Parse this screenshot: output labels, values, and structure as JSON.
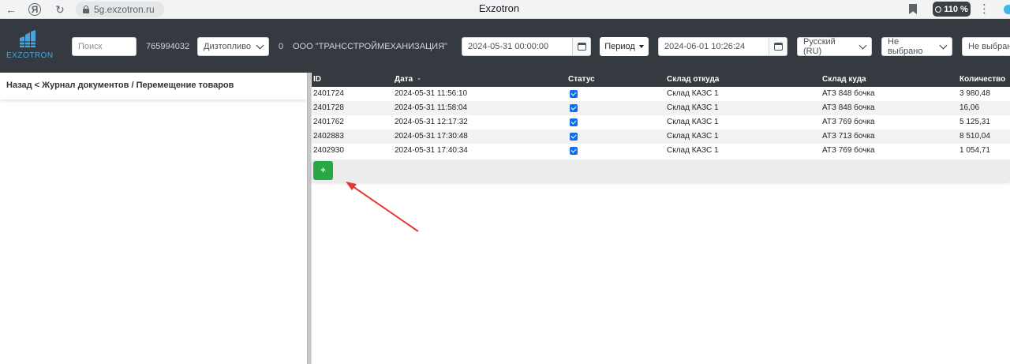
{
  "browser": {
    "url": "5g.exzotron.ru",
    "page_title": "Exzotron",
    "zoom_label": "110 %",
    "back_glyph": "←",
    "yandex_glyph": "Я",
    "reload_glyph": "↻",
    "menu_glyph": "⋮"
  },
  "header": {
    "logo_text": "EXZOTRON",
    "search_placeholder": "Поиск",
    "account_number": "765994032",
    "fuel_select": "Дизтопливо",
    "counter": "0",
    "company_name": "ООО \"ТРАНССТРОЙМЕХАНИЗАЦИЯ\"",
    "date_from": "2024-05-31 00:00:00",
    "period_button": "Период",
    "date_to": "2024-06-01 10:26:24",
    "language_select": "Русский (RU)",
    "filter1_select": "Не выбрано",
    "filter2_select": "Не выбрано"
  },
  "breadcrumb": "Назад < Журнал документов / Перемещение товаров",
  "table": {
    "columns": [
      "ID",
      "Дата",
      "Статус",
      "Склад откуда",
      "Склад куда",
      "Количество"
    ],
    "rows": [
      {
        "id": "2401724",
        "date": "2024-05-31 11:56:10",
        "status_checked": true,
        "from": "Склад КАЗС 1",
        "to": "АТЗ 848 бочка",
        "qty": "3 980,48"
      },
      {
        "id": "2401728",
        "date": "2024-05-31 11:58:04",
        "status_checked": true,
        "from": "Склад КАЗС 1",
        "to": "АТЗ 848 бочка",
        "qty": "16,06"
      },
      {
        "id": "2401762",
        "date": "2024-05-31 12:17:32",
        "status_checked": true,
        "from": "Склад КАЗС 1",
        "to": "АТЗ 769 бочка",
        "qty": "5 125,31"
      },
      {
        "id": "2402883",
        "date": "2024-05-31 17:30:48",
        "status_checked": true,
        "from": "Склад КАЗС 1",
        "to": "АТЗ 713 бочка",
        "qty": "8 510,04"
      },
      {
        "id": "2402930",
        "date": "2024-05-31 17:40:34",
        "status_checked": true,
        "from": "Склад КАЗС 1",
        "to": "АТЗ 769 бочка",
        "qty": "1 054,71"
      }
    ],
    "add_button": "+"
  },
  "colors": {
    "header_bg": "#343a40",
    "add_button": "#28a745",
    "checkbox": "#0b6ff0",
    "annotation_arrow": "#e53935",
    "logo": "#4aa3df"
  },
  "icons": {
    "back": "back-arrow-icon",
    "yandex": "yandex-icon",
    "reload": "reload-icon",
    "lock": "lock-icon",
    "bookmark": "bookmark-icon",
    "zoom": "zoom-icon",
    "menu": "more-vert-icon",
    "calendar": "calendar-icon",
    "annotation": "red-arrow-icon"
  }
}
